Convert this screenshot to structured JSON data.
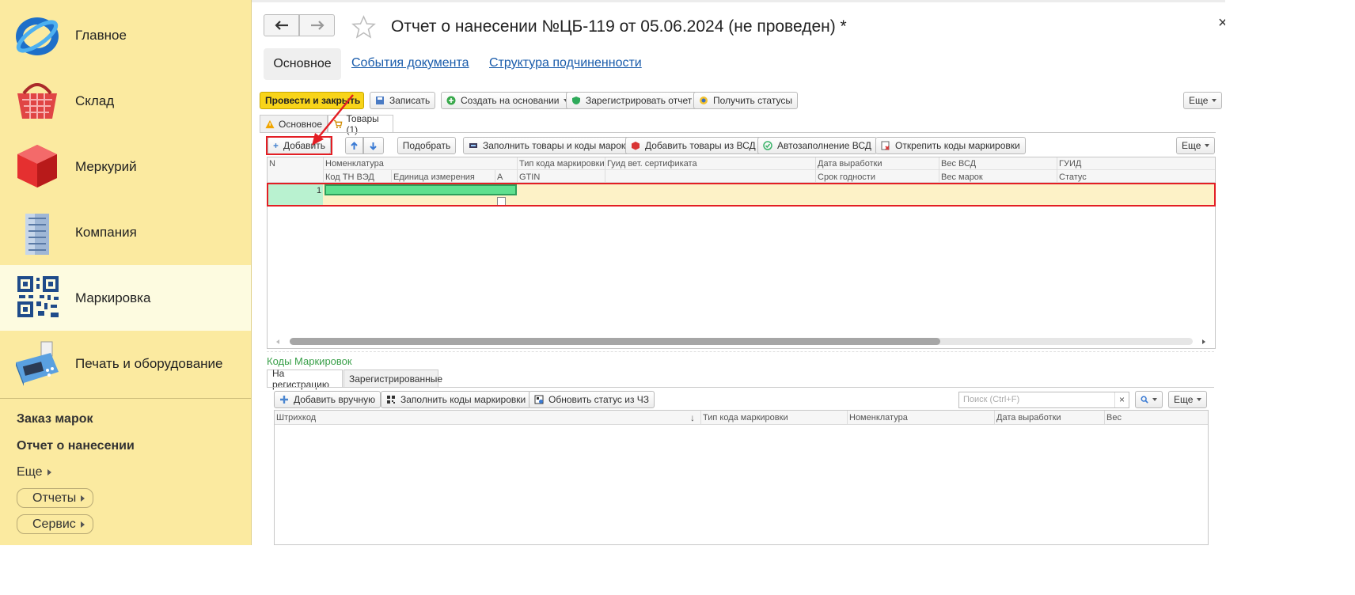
{
  "sidebar": {
    "items": [
      {
        "label": "Главное",
        "icon": "logo-icon"
      },
      {
        "label": "Склад",
        "icon": "basket-icon"
      },
      {
        "label": "Меркурий",
        "icon": "cube-icon"
      },
      {
        "label": "Компания",
        "icon": "building-icon"
      },
      {
        "label": "Маркировка",
        "icon": "qr-code-icon"
      },
      {
        "label": "Печать и оборудование",
        "icon": "cash-register-icon"
      }
    ],
    "links": [
      "Заказ марок",
      "Отчет о нанесении"
    ],
    "more": "Еще",
    "buttons": [
      "Отчеты",
      "Сервис"
    ]
  },
  "header": {
    "title": "Отчет о нанесении №ЦБ-119 от 05.06.2024 (не проведен) *",
    "close": "×",
    "tabs": [
      "Основное",
      "События документа",
      "Структура подчиненности"
    ]
  },
  "toolbar": {
    "post_close": "Провести и закрыть",
    "save": "Записать",
    "create_based": "Создать на основании",
    "register_report": "Зарегистрировать отчет",
    "get_statuses": "Получить статусы",
    "more": "Еще"
  },
  "subtabs": [
    "Основное",
    "Товары (1)"
  ],
  "goods_toolbar": {
    "add": "Добавить",
    "pick": "Подобрать",
    "fill_goods": "Заполнить товары и коды марок",
    "add_vsd": "Добавить товары из ВСД",
    "autofill_vsd": "Автозаполнение ВСД",
    "detach_codes": "Открепить коды маркировки",
    "more": "Еще"
  },
  "goods_grid": {
    "headers_row1": [
      "N",
      "Номенклатура",
      "Тип кода маркировки",
      "Гуид вет. сертификата",
      "Дата выработки",
      "Вес ВСД",
      "ГУИД"
    ],
    "headers_row2": [
      "Код ТН ВЭД",
      "Единица измерения",
      "А",
      "GTIN",
      "Срок годности",
      "Вес марок",
      "Статус"
    ],
    "rows": [
      {
        "n": "1"
      }
    ]
  },
  "codes": {
    "title": "Коды Маркировок",
    "tabs": [
      "На регистрацию",
      "Зарегистрированные"
    ],
    "add_manual": "Добавить вручную",
    "fill_codes": "Заполнить коды маркировки",
    "update_status": "Обновить статус из ЧЗ",
    "search_placeholder": "Поиск (Ctrl+F)",
    "more": "Еще",
    "headers": [
      "Штрихкод",
      "Тип кода маркировки",
      "Номенклатура",
      "Дата выработки",
      "Вес"
    ]
  },
  "colors": {
    "accent": "#f8d419",
    "highlight": "#e31e24",
    "sidebar": "#fbeaa0",
    "link": "#1a5cab"
  }
}
